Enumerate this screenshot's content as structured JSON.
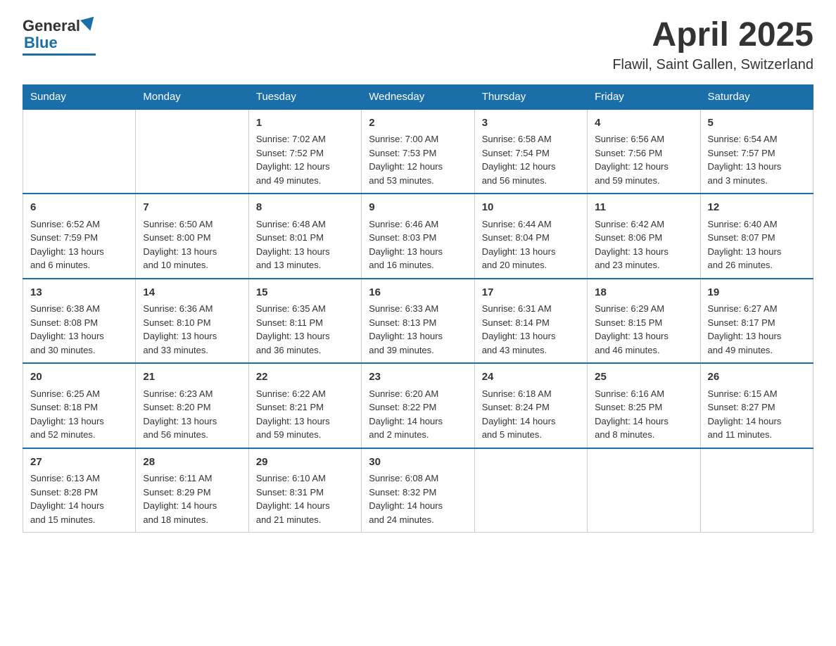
{
  "header": {
    "logo_general": "General",
    "logo_blue": "Blue",
    "month": "April 2025",
    "location": "Flawil, Saint Gallen, Switzerland"
  },
  "weekdays": [
    "Sunday",
    "Monday",
    "Tuesday",
    "Wednesday",
    "Thursday",
    "Friday",
    "Saturday"
  ],
  "weeks": [
    [
      {
        "day": "",
        "info": ""
      },
      {
        "day": "",
        "info": ""
      },
      {
        "day": "1",
        "info": "Sunrise: 7:02 AM\nSunset: 7:52 PM\nDaylight: 12 hours\nand 49 minutes."
      },
      {
        "day": "2",
        "info": "Sunrise: 7:00 AM\nSunset: 7:53 PM\nDaylight: 12 hours\nand 53 minutes."
      },
      {
        "day": "3",
        "info": "Sunrise: 6:58 AM\nSunset: 7:54 PM\nDaylight: 12 hours\nand 56 minutes."
      },
      {
        "day": "4",
        "info": "Sunrise: 6:56 AM\nSunset: 7:56 PM\nDaylight: 12 hours\nand 59 minutes."
      },
      {
        "day": "5",
        "info": "Sunrise: 6:54 AM\nSunset: 7:57 PM\nDaylight: 13 hours\nand 3 minutes."
      }
    ],
    [
      {
        "day": "6",
        "info": "Sunrise: 6:52 AM\nSunset: 7:59 PM\nDaylight: 13 hours\nand 6 minutes."
      },
      {
        "day": "7",
        "info": "Sunrise: 6:50 AM\nSunset: 8:00 PM\nDaylight: 13 hours\nand 10 minutes."
      },
      {
        "day": "8",
        "info": "Sunrise: 6:48 AM\nSunset: 8:01 PM\nDaylight: 13 hours\nand 13 minutes."
      },
      {
        "day": "9",
        "info": "Sunrise: 6:46 AM\nSunset: 8:03 PM\nDaylight: 13 hours\nand 16 minutes."
      },
      {
        "day": "10",
        "info": "Sunrise: 6:44 AM\nSunset: 8:04 PM\nDaylight: 13 hours\nand 20 minutes."
      },
      {
        "day": "11",
        "info": "Sunrise: 6:42 AM\nSunset: 8:06 PM\nDaylight: 13 hours\nand 23 minutes."
      },
      {
        "day": "12",
        "info": "Sunrise: 6:40 AM\nSunset: 8:07 PM\nDaylight: 13 hours\nand 26 minutes."
      }
    ],
    [
      {
        "day": "13",
        "info": "Sunrise: 6:38 AM\nSunset: 8:08 PM\nDaylight: 13 hours\nand 30 minutes."
      },
      {
        "day": "14",
        "info": "Sunrise: 6:36 AM\nSunset: 8:10 PM\nDaylight: 13 hours\nand 33 minutes."
      },
      {
        "day": "15",
        "info": "Sunrise: 6:35 AM\nSunset: 8:11 PM\nDaylight: 13 hours\nand 36 minutes."
      },
      {
        "day": "16",
        "info": "Sunrise: 6:33 AM\nSunset: 8:13 PM\nDaylight: 13 hours\nand 39 minutes."
      },
      {
        "day": "17",
        "info": "Sunrise: 6:31 AM\nSunset: 8:14 PM\nDaylight: 13 hours\nand 43 minutes."
      },
      {
        "day": "18",
        "info": "Sunrise: 6:29 AM\nSunset: 8:15 PM\nDaylight: 13 hours\nand 46 minutes."
      },
      {
        "day": "19",
        "info": "Sunrise: 6:27 AM\nSunset: 8:17 PM\nDaylight: 13 hours\nand 49 minutes."
      }
    ],
    [
      {
        "day": "20",
        "info": "Sunrise: 6:25 AM\nSunset: 8:18 PM\nDaylight: 13 hours\nand 52 minutes."
      },
      {
        "day": "21",
        "info": "Sunrise: 6:23 AM\nSunset: 8:20 PM\nDaylight: 13 hours\nand 56 minutes."
      },
      {
        "day": "22",
        "info": "Sunrise: 6:22 AM\nSunset: 8:21 PM\nDaylight: 13 hours\nand 59 minutes."
      },
      {
        "day": "23",
        "info": "Sunrise: 6:20 AM\nSunset: 8:22 PM\nDaylight: 14 hours\nand 2 minutes."
      },
      {
        "day": "24",
        "info": "Sunrise: 6:18 AM\nSunset: 8:24 PM\nDaylight: 14 hours\nand 5 minutes."
      },
      {
        "day": "25",
        "info": "Sunrise: 6:16 AM\nSunset: 8:25 PM\nDaylight: 14 hours\nand 8 minutes."
      },
      {
        "day": "26",
        "info": "Sunrise: 6:15 AM\nSunset: 8:27 PM\nDaylight: 14 hours\nand 11 minutes."
      }
    ],
    [
      {
        "day": "27",
        "info": "Sunrise: 6:13 AM\nSunset: 8:28 PM\nDaylight: 14 hours\nand 15 minutes."
      },
      {
        "day": "28",
        "info": "Sunrise: 6:11 AM\nSunset: 8:29 PM\nDaylight: 14 hours\nand 18 minutes."
      },
      {
        "day": "29",
        "info": "Sunrise: 6:10 AM\nSunset: 8:31 PM\nDaylight: 14 hours\nand 21 minutes."
      },
      {
        "day": "30",
        "info": "Sunrise: 6:08 AM\nSunset: 8:32 PM\nDaylight: 14 hours\nand 24 minutes."
      },
      {
        "day": "",
        "info": ""
      },
      {
        "day": "",
        "info": ""
      },
      {
        "day": "",
        "info": ""
      }
    ]
  ]
}
